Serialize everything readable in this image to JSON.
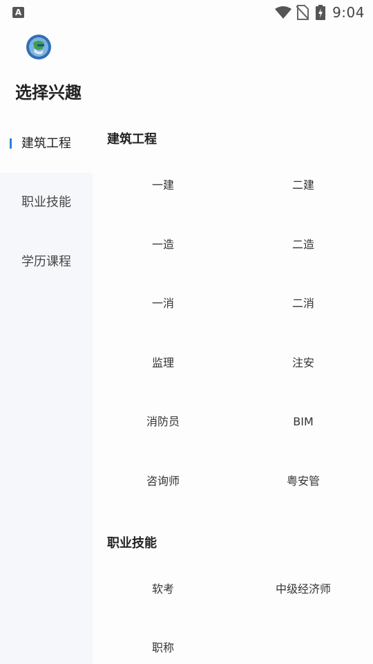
{
  "status_bar": {
    "time": "9:04",
    "left_icon": "A"
  },
  "page_title": "选择兴趣",
  "sidebar": {
    "items": [
      {
        "label": "建筑工程",
        "active": true
      },
      {
        "label": "职业技能",
        "active": false
      },
      {
        "label": "学历课程",
        "active": false
      }
    ]
  },
  "sections": [
    {
      "title": "建筑工程",
      "options": [
        "一建",
        "二建",
        "一造",
        "二造",
        "一消",
        "二消",
        "监理",
        "注安",
        "消防员",
        "BIM",
        "咨询师",
        "粤安管"
      ]
    },
    {
      "title": "职业技能",
      "options": [
        "软考",
        "中级经济师",
        "职称"
      ]
    }
  ],
  "colors": {
    "accent": "#2b7de9",
    "sidebar_bg": "#f6f7fb",
    "page_bg": "#fdfdfe"
  }
}
